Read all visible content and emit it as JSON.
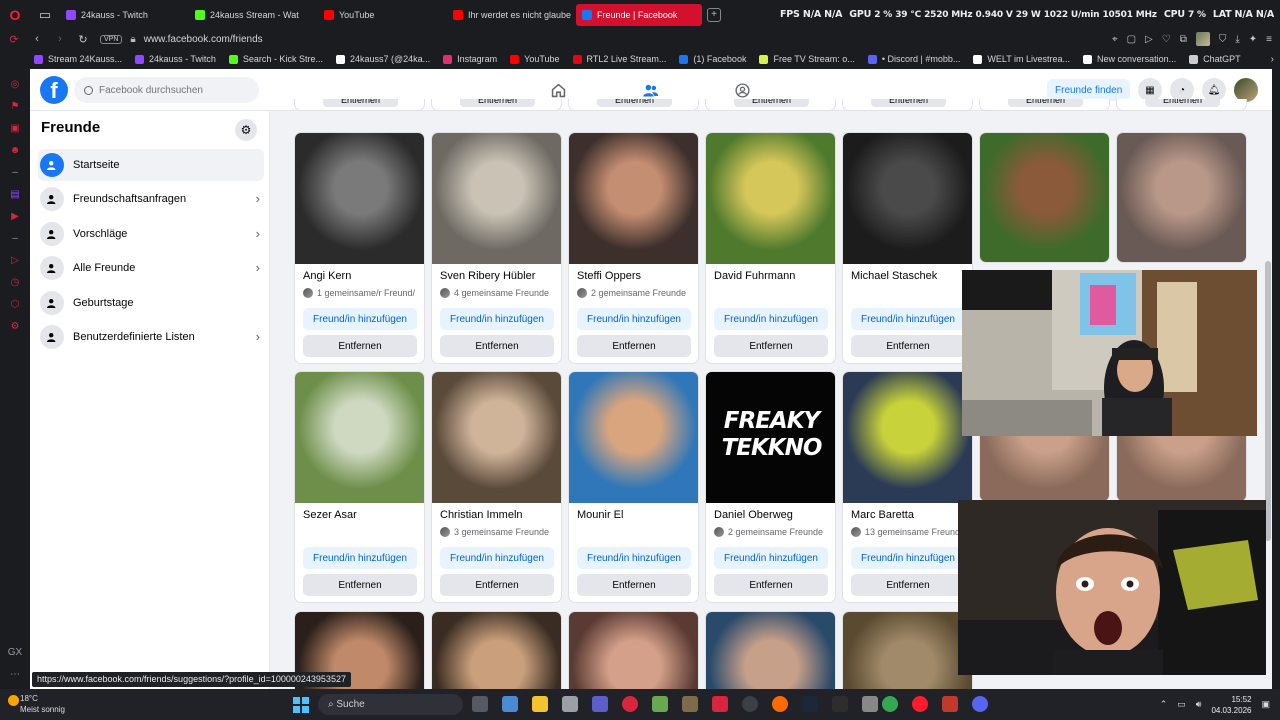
{
  "browser": {
    "tabs": [
      {
        "label": "24kauss - Twitch",
        "color": "#9146ff",
        "active": false
      },
      {
        "label": "24kauss Stream - Wat",
        "color": "#53fc18",
        "active": false
      },
      {
        "label": "YouTube",
        "color": "#ff0000",
        "active": false
      },
      {
        "label": "Ihr werdet es nicht glaube",
        "color": "#ff0000",
        "active": false
      },
      {
        "label": "Freunde | Facebook",
        "color": "#1877f2",
        "active": true
      }
    ],
    "url": "www.facebook.com/friends",
    "vpn_label": "VPN",
    "hud": {
      "fps_label": "FPS",
      "fps_a": "N/A",
      "fps_b": "N/A",
      "gpu_label": "GPU",
      "gpu_pct": "2 %",
      "gpu_temp": "39 °C",
      "gpu_clock": "2520 MHz",
      "gpu_volt": "0.940 V",
      "gpu_watt": "29 W",
      "gpu_fan": "1022 U/min",
      "gpu_mem": "10501 MHz",
      "cpu_label": "CPU",
      "cpu_pct": "7 %",
      "lat_label": "LAT",
      "lat_a": "N/A",
      "lat_b": "N/A"
    },
    "bookmarks": [
      {
        "label": "Stream 24Kauss...",
        "color": "#9146ff"
      },
      {
        "label": "24kauss - Twitch",
        "color": "#9146ff"
      },
      {
        "label": "Search - Kick Stre...",
        "color": "#53fc18"
      },
      {
        "label": "24kauss7 (@24ka...",
        "color": "#ffffff"
      },
      {
        "label": "Instagram",
        "color": "#e1306c"
      },
      {
        "label": "YouTube",
        "color": "#ff0000"
      },
      {
        "label": "RTL2 Live Stream...",
        "color": "#e30613"
      },
      {
        "label": "(1) Facebook",
        "color": "#1877f2"
      },
      {
        "label": "Free TV Stream: o...",
        "color": "#d6f24c"
      },
      {
        "label": "• Discord | #mobb...",
        "color": "#5865f2"
      },
      {
        "label": "WELT im Livestrea...",
        "color": "#ffffff"
      },
      {
        "label": "New conversation...",
        "color": "#ffffff"
      },
      {
        "label": "ChatGPT",
        "color": "#cccccc"
      }
    ]
  },
  "facebook": {
    "search_placeholder": "Facebook durchsuchen",
    "find_friends": "Freunde finden",
    "left_title": "Freunde",
    "left_items": [
      {
        "label": "Startseite",
        "icon": "friends-home-icon"
      },
      {
        "label": "Freundschaftsanfragen",
        "icon": "friend-requests-icon"
      },
      {
        "label": "Vorschläge",
        "icon": "suggestions-icon"
      },
      {
        "label": "Alle Freunde",
        "icon": "all-friends-icon"
      },
      {
        "label": "Geburtstage",
        "icon": "birthday-icon"
      },
      {
        "label": "Benutzerdefinierte Listen",
        "icon": "custom-lists-icon"
      }
    ],
    "stub_label": "Entfernen",
    "add_label": "Freund/in hinzufügen",
    "remove_label": "Entfernen",
    "row1": [
      {
        "name": "Angi Kern",
        "mutual": "1 gemeinsame/r Freund/"
      },
      {
        "name": "Sven Ribery Hübler",
        "mutual": "4 gemeinsame Freunde"
      },
      {
        "name": "Steffi Oppers",
        "mutual": "2 gemeinsame Freunde"
      },
      {
        "name": "David Fuhrmann",
        "mutual": ""
      },
      {
        "name": "Michael Staschek",
        "mutual": ""
      }
    ],
    "row2": [
      {
        "name": "Sezer Asar",
        "mutual": ""
      },
      {
        "name": "Christian Immeln",
        "mutual": "3 gemeinsame Freunde"
      },
      {
        "name": "Mounir El",
        "mutual": ""
      },
      {
        "name": "Daniel Oberweg",
        "mutual": "2 gemeinsame Freunde"
      },
      {
        "name": "Marc Baretta",
        "mutual": "13 gemeinsame Freunde"
      }
    ],
    "freaky_logo": "FREAKY TEKKNO"
  },
  "status_url": "https://www.facebook.com/friends/suggestions/?profile_id=100000243953527",
  "taskbar": {
    "temp": "18°C",
    "weather": "Meist sonnig",
    "search": "Suche",
    "time": "15:52",
    "date": "04.03.2026"
  }
}
